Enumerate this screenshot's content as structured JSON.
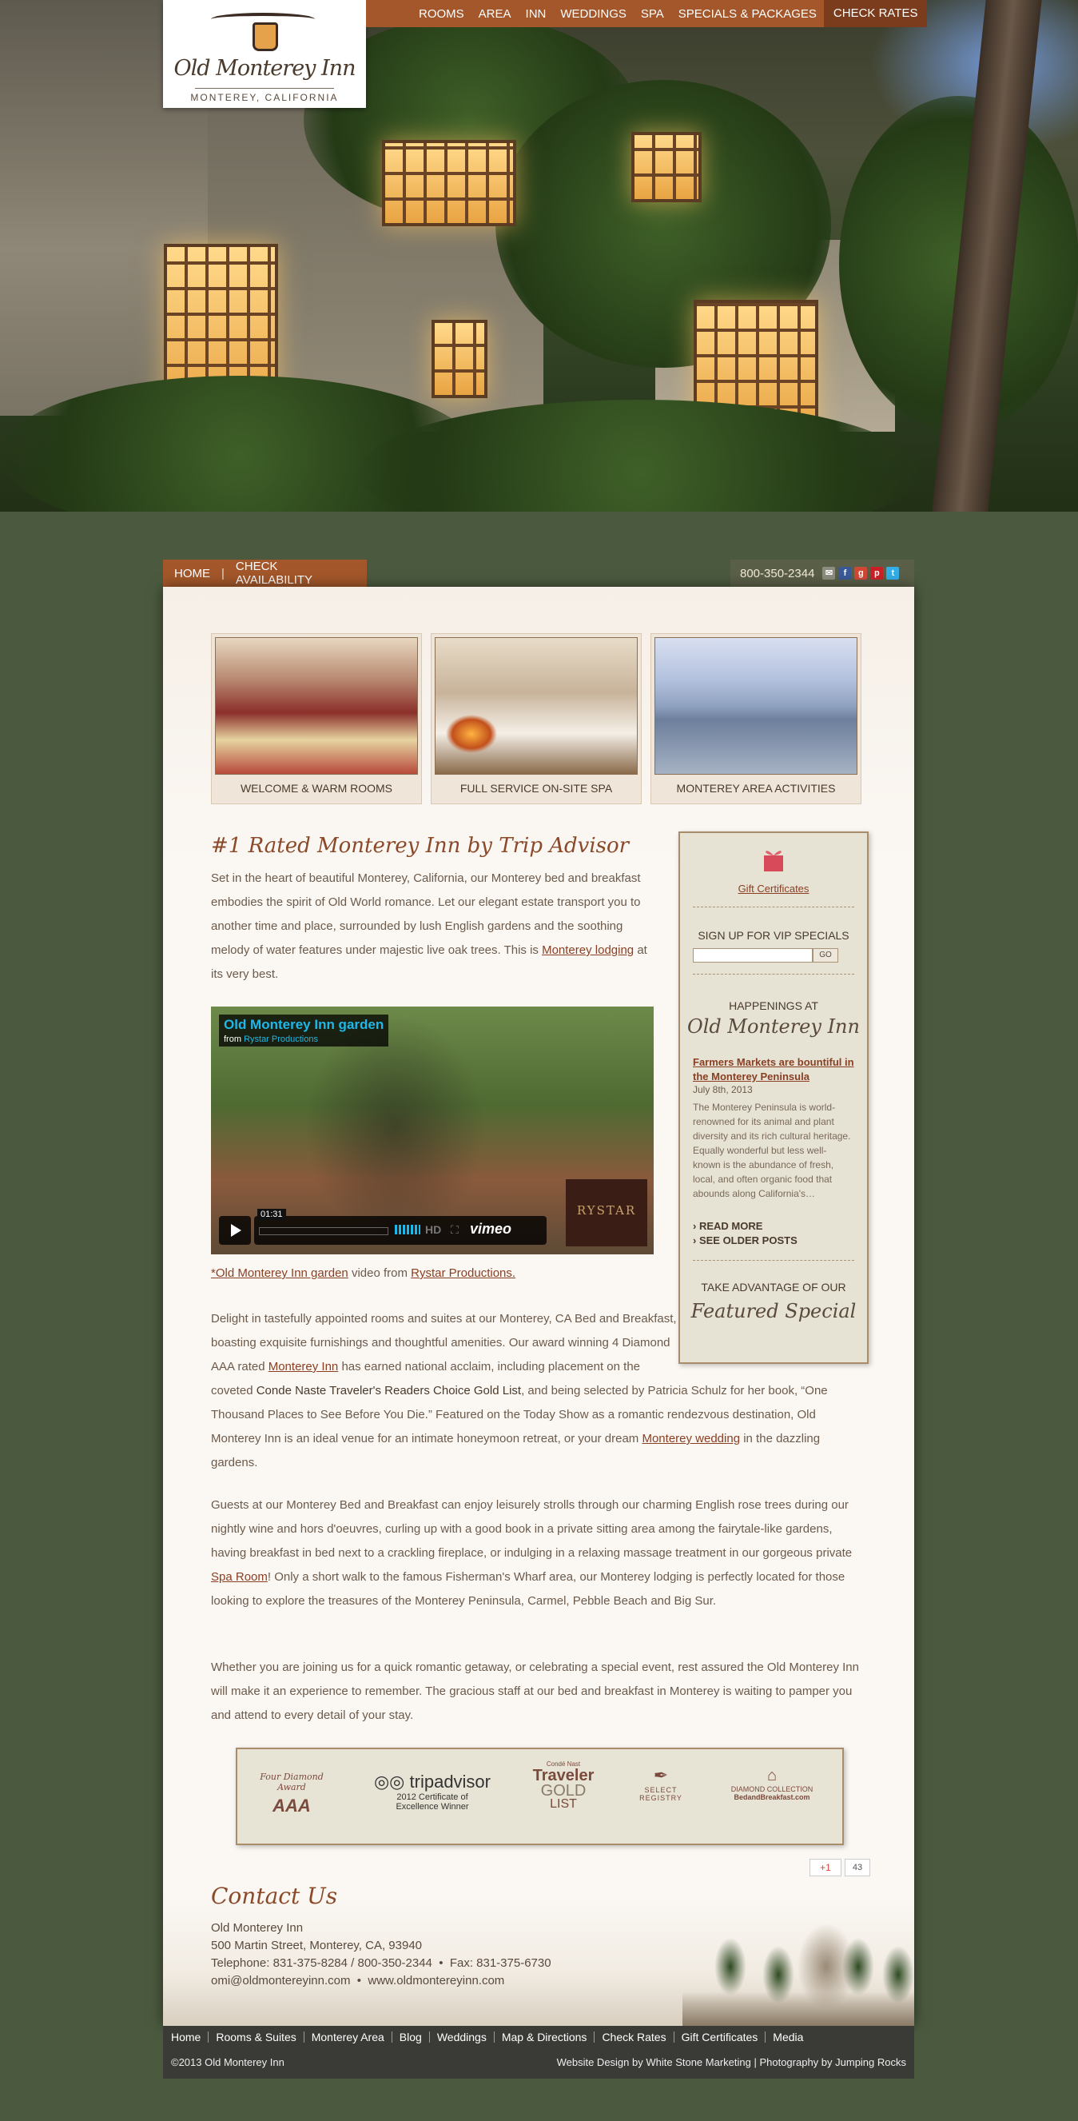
{
  "top_nav": {
    "items": [
      "ROOMS",
      "AREA",
      "INN",
      "WEDDINGS",
      "SPA",
      "SPECIALS & PACKAGES"
    ],
    "check_rates": "CHECK RATES"
  },
  "logo": {
    "name": "Old Monterey Inn",
    "location": "MONTEREY, CALIFORNIA"
  },
  "sub_nav": {
    "home": "HOME",
    "separator": "|",
    "check_availability": "CHECK AVAILABILITY"
  },
  "contact_bar": {
    "phone": "800-350-2344",
    "icons": [
      "email-icon",
      "facebook-icon",
      "google-plus-icon",
      "pinterest-icon",
      "twitter-icon"
    ]
  },
  "features": [
    {
      "caption": "WELCOME & WARM ROOMS"
    },
    {
      "caption": "FULL SERVICE ON-SITE SPA"
    },
    {
      "caption": "MONTEREY AREA ACTIVITIES"
    }
  ],
  "intro": {
    "heading": "#1 Rated Monterey Inn by Trip Advisor",
    "text": "Set in the heart of beautiful Monterey, California, our Monterey bed and breakfast embodies the spirit of Old World romance. Let our elegant estate transport you to another time and place, surrounded by lush English gardens and the soothing melody of water features under majestic live oak trees. This is",
    "link": "Monterey lodging",
    "tail": "at its very best."
  },
  "video": {
    "title": "Old Monterey Inn garden",
    "from_label": "from",
    "from_name": "Rystar Productions",
    "time": "01:31",
    "hd": "HD",
    "brand": "vimeo",
    "watermark": "RYSTAR",
    "caption_link": "*Old Monterey Inn garden",
    "caption_mid": "video from",
    "caption_link2": "Rystar Productions."
  },
  "para2": {
    "a": "Delight in tastefully appointed rooms and suites at our Monterey, CA Bed and Breakfast, boasting exquisite furnishings and thoughtful amenities. Our award winning 4 Diamond AAA rated",
    "link1": "Monterey Inn",
    "b": "has earned national acclaim, including placement on the coveted",
    "strong": "Conde Naste Traveler's Readers Choice Gold List",
    "c": ", and being selected by Patricia Schulz for her book, “One Thousand Places to See Before You Die.” Featured on the Today Show as a romantic rendezvous destination, Old Monterey Inn is an ideal venue for an intimate honeymoon retreat, or your dream",
    "link2": "Monterey wedding",
    "d": "in the dazzling gardens."
  },
  "para3": {
    "a": "Guests at our Monterey Bed and Breakfast can enjoy leisurely strolls through our charming English rose trees during our nightly wine and hors d'oeuvres, curling up with a good book in a private sitting area among the fairytale-like gardens, having breakfast in bed next to a crackling fireplace, or indulging in a relaxing massage treatment in our gorgeous private",
    "link": "Spa Room",
    "b": "! Only a short walk to the famous Fisherman's Wharf area, our Monterey lodging is perfectly located for those looking to explore the treasures of the Monterey Peninsula, Carmel, Pebble Beach and Big Sur."
  },
  "para4": "Whether you are joining us for a quick romantic getaway, or celebrating a special event, rest assured the Old Monterey Inn will make it an experience to remember. The gracious staff at our bed and breakfast in Monterey is waiting to pamper you and attend to every detail of your stay.",
  "sidebar": {
    "gift": "Gift Certificates",
    "vip": "SIGN UP FOR VIP SPECIALS",
    "go": "GO",
    "happenings": "HAPPENINGS AT",
    "happenings_script": "Old Monterey Inn",
    "post_title": "Farmers Markets are bountiful in the Monterey Peninsula",
    "post_date": "July 8th, 2013",
    "post_excerpt": "The Monterey Peninsula is world-renowned for its animal and plant diversity and its rich cultural heritage.  Equally wonderful but less well-known is the abundance of fresh, local, and often organic food that abounds along California's…",
    "read_more": "› READ MORE",
    "older": "› SEE OLDER POSTS",
    "take_adv": "TAKE ADVANTAGE OF OUR",
    "featured": "Featured Special"
  },
  "awards": {
    "aaa_top": "Four Diamond Award",
    "aaa": "AAA",
    "tripadvisor": "tripadvisor",
    "trip_sub1": "2012 Certificate of",
    "trip_sub2": "Excellence Winner",
    "cn_top": "Condé Nast",
    "cn_main": "Traveler",
    "cn_gold": "GOLD",
    "cn_list": "LIST",
    "select": "SELECT REGISTRY",
    "diamond1": "DIAMOND COLLECTION",
    "diamond2": "BedandBreakfast.com"
  },
  "gplus": {
    "label": "+1",
    "count": "43"
  },
  "contact": {
    "heading": "Contact Us",
    "name": "Old Monterey Inn",
    "address": "500 Martin Street, Monterey, CA, 93940",
    "telephone": "Telephone: 831-375-8284 / 800-350-2344  •  Fax: 831-375-6730",
    "email_web": "omi@oldmontereyinn.com  •  www.oldmontereyinn.com"
  },
  "footer_nav": [
    "Home",
    "Rooms & Suites",
    "Monterey Area",
    "Blog",
    "Weddings",
    "Map & Directions",
    "Check Rates",
    "Gift Certificates",
    "Media"
  ],
  "footer": {
    "copyright": "©2013 Old Monterey Inn",
    "credits": "Website Design by White Stone Marketing | Photography by Jumping Rocks"
  }
}
